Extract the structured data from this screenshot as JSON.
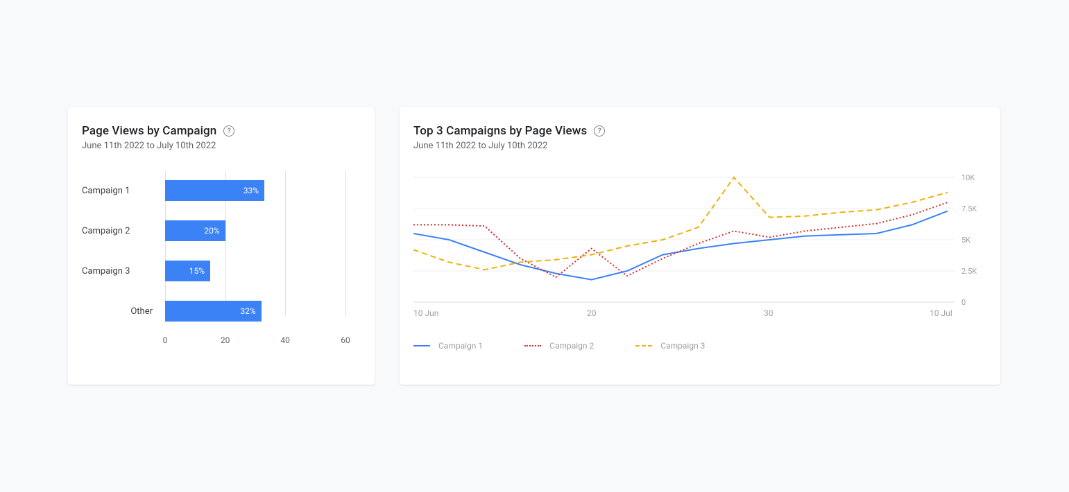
{
  "chart_data": [
    {
      "type": "bar",
      "title": "Page Views by Campaign",
      "subtitle": "June 11th 2022 to July 10th 2022",
      "categories": [
        "Campaign 1",
        "Campaign 2",
        "Campaign 3",
        "Other"
      ],
      "values": [
        33,
        20,
        15,
        32
      ],
      "value_suffix": "%",
      "xlim": [
        0,
        60
      ],
      "x_ticks": [
        0,
        20,
        40,
        60
      ]
    },
    {
      "type": "line",
      "title": "Top 3 Campaigns by Page Views",
      "subtitle": "June 11th 2022 to July 10th 2022",
      "x": [
        10,
        12,
        14,
        16,
        18,
        20,
        22,
        24,
        26,
        28,
        30,
        2,
        4,
        6,
        8,
        10.5
      ],
      "x_tick_labels": [
        "10 Jun",
        "20",
        "30",
        "10 Jul"
      ],
      "x_tick_values": [
        10,
        20,
        30,
        40.5
      ],
      "ylim": [
        0,
        10000
      ],
      "y_ticks": [
        0,
        2500,
        5000,
        7500,
        10000
      ],
      "y_tick_labels": [
        "0",
        "2.5K",
        "5K",
        "7.5K",
        "10K"
      ],
      "series": [
        {
          "name": "Campaign 1",
          "color": "#3b82f6",
          "style": "solid",
          "values": [
            5500,
            5000,
            4000,
            3000,
            2300,
            1800,
            2500,
            3800,
            4300,
            4700,
            5000,
            5300,
            5400,
            5500,
            6200,
            7300
          ]
        },
        {
          "name": "Campaign 2",
          "color": "#dc2626",
          "style": "dotted",
          "values": [
            6200,
            6200,
            6100,
            3500,
            2000,
            4300,
            2100,
            3500,
            4700,
            5700,
            5200,
            5700,
            6000,
            6300,
            7000,
            8000
          ]
        },
        {
          "name": "Campaign 3",
          "color": "#eab308",
          "style": "dashed",
          "values": [
            4200,
            3200,
            2600,
            3200,
            3400,
            3800,
            4500,
            5000,
            6000,
            10000,
            6800,
            6900,
            7200,
            7400,
            8000,
            8800
          ]
        }
      ]
    }
  ],
  "left": {
    "title": "Page Views by Campaign",
    "subtitle": "June 11th 2022 to July 10th 2022",
    "help_icon": "?",
    "rows": [
      {
        "label": "Campaign 1",
        "value_text": "33%"
      },
      {
        "label": "Campaign 2",
        "value_text": "20%"
      },
      {
        "label": "Campaign 3",
        "value_text": "15%"
      },
      {
        "label": "Other",
        "value_text": "32%"
      }
    ],
    "x_ticks": [
      "0",
      "20",
      "40",
      "60"
    ]
  },
  "right": {
    "title": "Top 3 Campaigns by Page Views",
    "subtitle": "June 11th 2022 to July 10th 2022",
    "help_icon": "?",
    "legend": [
      "Campaign 1",
      "Campaign 2",
      "Campaign 3"
    ],
    "x_ticks": [
      "10 Jun",
      "20",
      "30",
      "10 Jul"
    ],
    "y_ticks": [
      "0",
      "2.5K",
      "5K",
      "7.5K",
      "10K"
    ]
  }
}
